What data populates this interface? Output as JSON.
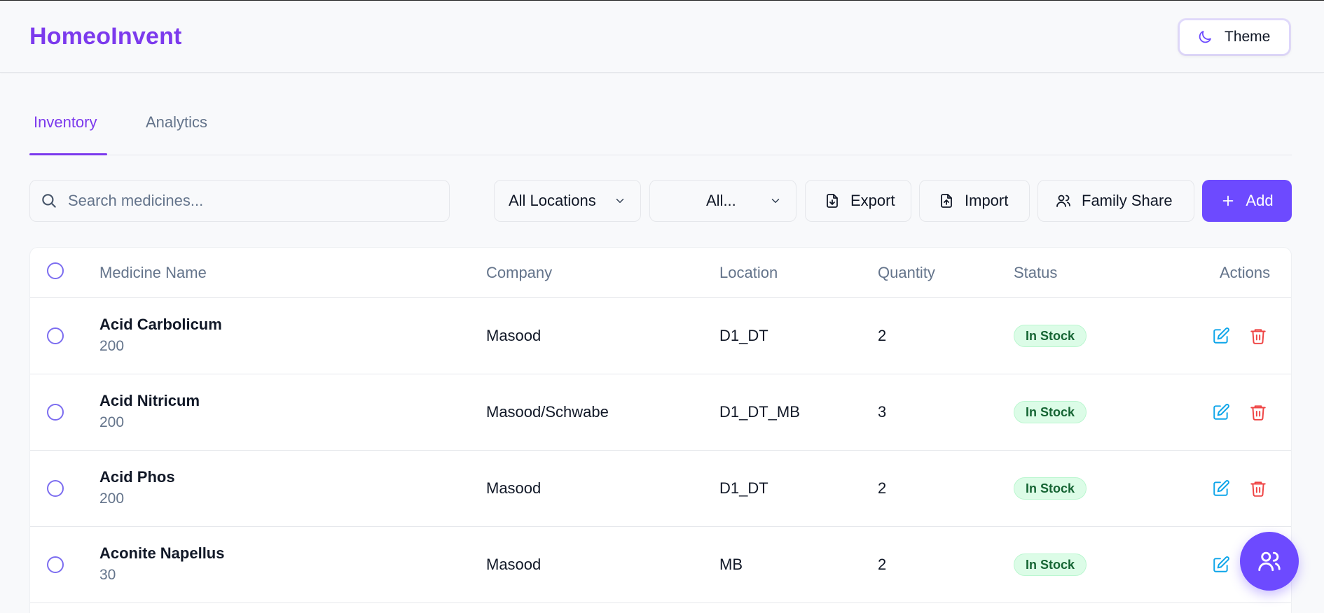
{
  "app": {
    "title": "HomeoInvent"
  },
  "header": {
    "theme_label": "Theme"
  },
  "tabs": [
    {
      "label": "Inventory",
      "active": true
    },
    {
      "label": "Analytics",
      "active": false
    }
  ],
  "toolbar": {
    "search_placeholder": "Search medicines...",
    "location_filter": "All Locations",
    "second_filter": "All...",
    "export_label": "Export",
    "import_label": "Import",
    "family_share_label": "Family Share",
    "add_label": "Add"
  },
  "table": {
    "columns": [
      "Medicine Name",
      "Company",
      "Location",
      "Quantity",
      "Status",
      "Actions"
    ],
    "rows": [
      {
        "name": "Acid Carbolicum",
        "potency": "200",
        "company": "Masood",
        "location": "D1_DT",
        "quantity": "2",
        "status": "In Stock"
      },
      {
        "name": "Acid Nitricum",
        "potency": "200",
        "company": "Masood/Schwabe",
        "location": "D1_DT_MB",
        "quantity": "3",
        "status": "In Stock"
      },
      {
        "name": "Acid Phos",
        "potency": "200",
        "company": "Masood",
        "location": "D1_DT",
        "quantity": "2",
        "status": "In Stock"
      },
      {
        "name": "Aconite Napellus",
        "potency": "30",
        "company": "Masood",
        "location": "MB",
        "quantity": "2",
        "status": "In Stock"
      }
    ]
  },
  "colors": {
    "accent": "#7c3aed",
    "primary_button": "#6d4aff",
    "in_stock_bg": "#dcfce7",
    "in_stock_text": "#166534",
    "edit_icon": "#0ea5e9",
    "delete_icon": "#ef4444"
  },
  "icons": {
    "theme": "moon-icon",
    "search": "search-icon",
    "export": "file-download-icon",
    "import": "file-upload-icon",
    "family_share": "users-icon",
    "add": "plus-icon",
    "edit": "edit-icon",
    "delete": "trash-icon",
    "fab": "users-icon"
  }
}
